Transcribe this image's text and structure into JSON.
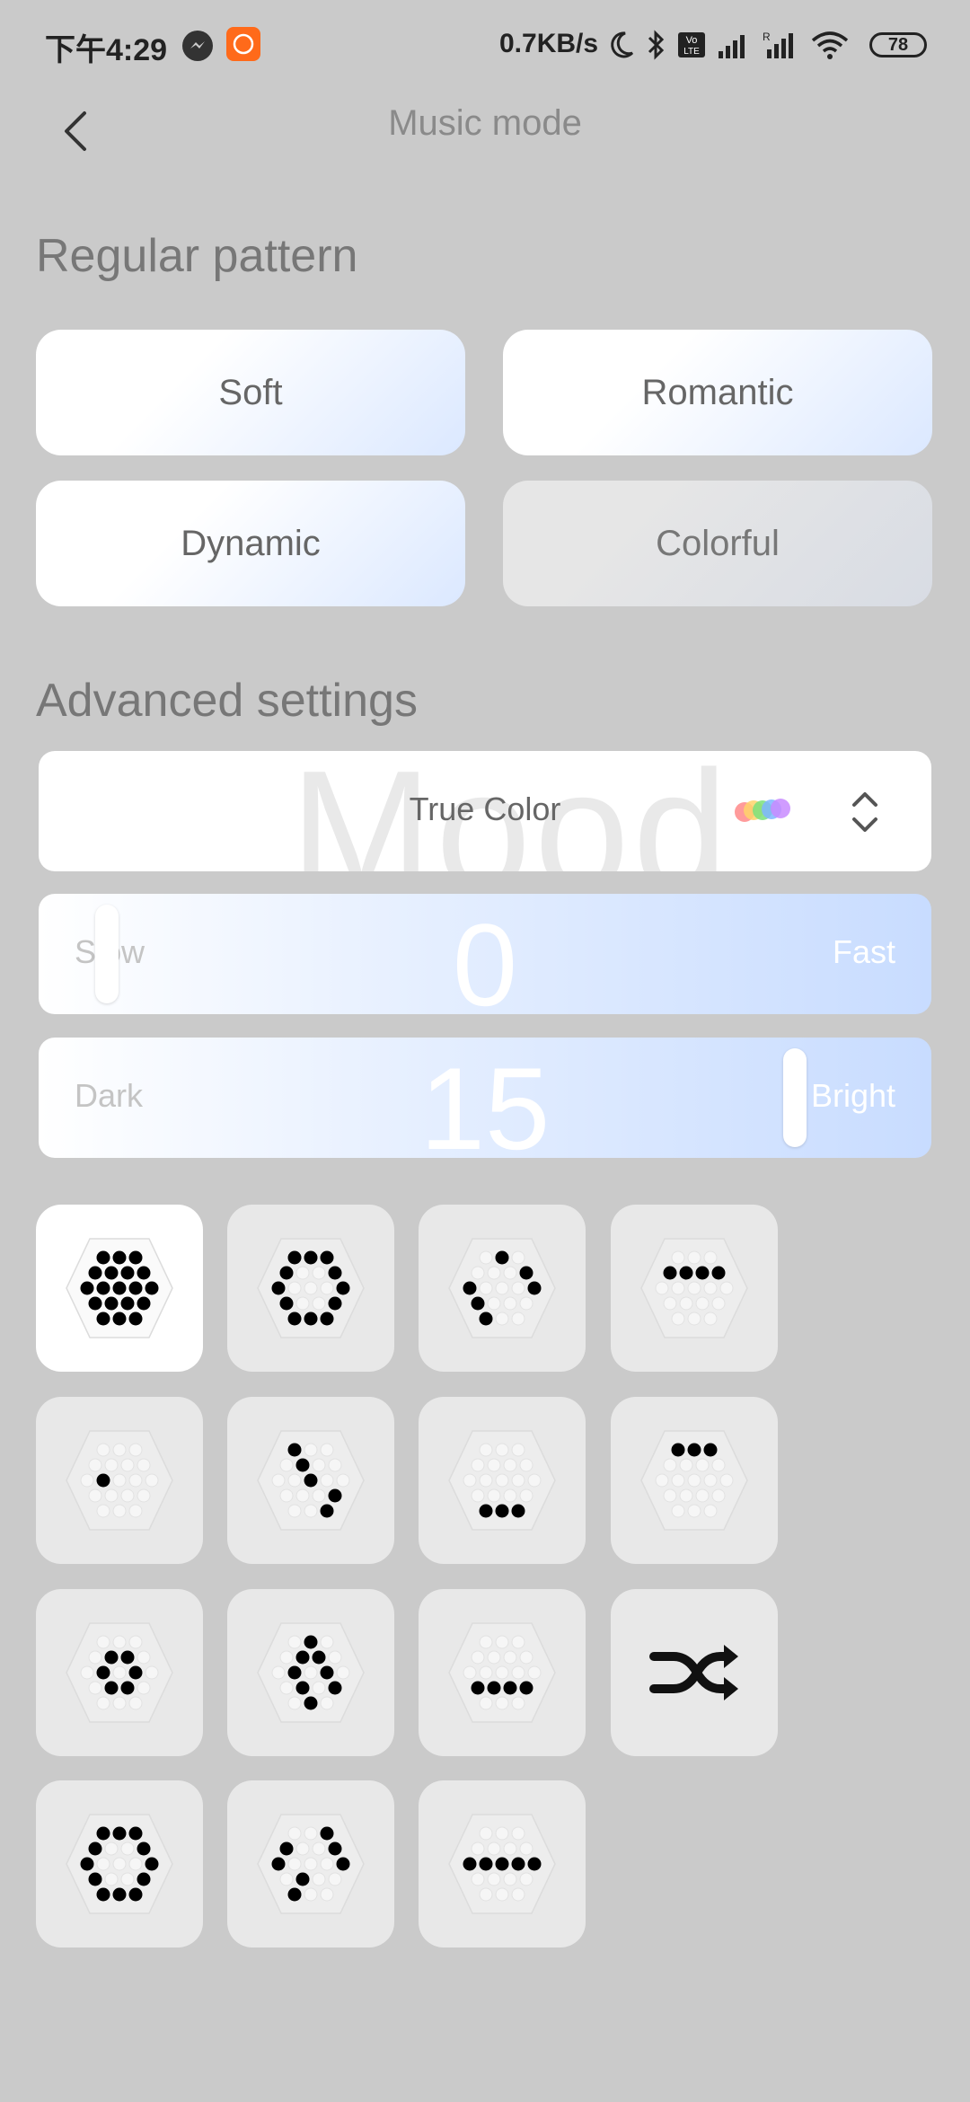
{
  "status_bar": {
    "time": "下午4:29",
    "speed": "0.7KB/s",
    "battery": "78",
    "icons": [
      "messenger-icon",
      "app-icon",
      "moon-icon",
      "bluetooth-icon",
      "volte-icon",
      "signal-icon",
      "signal-roaming-icon",
      "wifi-icon",
      "battery-icon"
    ]
  },
  "header": {
    "title": "Music mode",
    "back_icon": "chevron-left-icon"
  },
  "regular_pattern": {
    "title": "Regular pattern",
    "buttons": [
      {
        "label": "Soft",
        "active": true
      },
      {
        "label": "Romantic",
        "active": true
      },
      {
        "label": "Dynamic",
        "active": true
      },
      {
        "label": "Colorful",
        "active": false
      }
    ]
  },
  "advanced": {
    "title": "Advanced settings",
    "mood": {
      "background_text": "Mood",
      "value": "True Color",
      "icon": "rainbow-dots-icon",
      "chevron": "up-down-chevron-icon"
    },
    "speed": {
      "left_label": "Slow",
      "right_label": "Fast",
      "value": "0",
      "fraction": 0.0
    },
    "brightness": {
      "left_label": "Dark",
      "right_label": "Bright",
      "value": "15",
      "fraction": 1.0
    }
  },
  "effects": {
    "selected_index": 0,
    "tiles": [
      {
        "name": "effect-full-hex",
        "pattern": "full"
      },
      {
        "name": "effect-ring",
        "pattern": "ring"
      },
      {
        "name": "effect-arc-right",
        "pattern": "arc-right"
      },
      {
        "name": "effect-top-row",
        "pattern": "top-row"
      },
      {
        "name": "effect-center-dot",
        "pattern": "center"
      },
      {
        "name": "effect-diagonal",
        "pattern": "diagonal"
      },
      {
        "name": "effect-bottom-row",
        "pattern": "bottom-row"
      },
      {
        "name": "effect-top-row-short",
        "pattern": "top-row-short"
      },
      {
        "name": "effect-small-cluster",
        "pattern": "cluster"
      },
      {
        "name": "effect-diamond",
        "pattern": "diamond"
      },
      {
        "name": "effect-lower-row",
        "pattern": "lower-row"
      },
      {
        "name": "effect-shuffle",
        "pattern": "shuffle",
        "icon": "shuffle-icon"
      },
      {
        "name": "effect-ring-large",
        "pattern": "ring-large"
      },
      {
        "name": "effect-arc-left",
        "pattern": "arc-left"
      },
      {
        "name": "effect-middle-row",
        "pattern": "middle-row"
      }
    ]
  },
  "colors": {
    "background": "#cacaca",
    "accent_blue": "#c8dcff",
    "dot": "#000000"
  }
}
